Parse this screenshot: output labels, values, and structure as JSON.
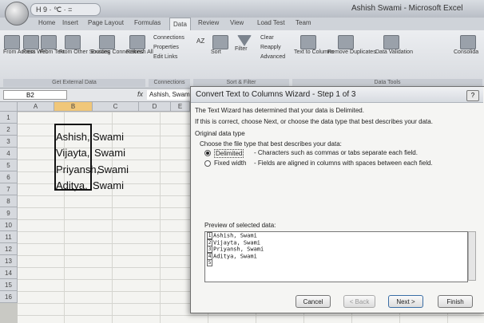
{
  "window": {
    "title": "Ashish Swami - Microsoft Excel",
    "qat_label": "H 9 · ℃ · ="
  },
  "ribbon": {
    "tabs": [
      "Home",
      "Insert",
      "Page Layout",
      "Formulas",
      "Data",
      "Review",
      "View",
      "Load Test",
      "Team"
    ],
    "active_tab": "Data",
    "buttons": {
      "from_access": "From Access",
      "from_web": "From Web",
      "from_text": "From Text",
      "from_other": "From Other Sources",
      "existing": "Existing Connections",
      "refresh": "Refresh All",
      "connections": "Connections",
      "properties": "Properties",
      "edit_links": "Edit Links",
      "sort": "Sort",
      "filter": "Filter",
      "clear": "Clear",
      "reapply": "Reapply",
      "advanced": "Advanced",
      "text_to_columns": "Text to Columns",
      "remove_duplicates": "Remove Duplicates",
      "data_validation": "Data Validation",
      "consolidate": "Consolida"
    },
    "groups": {
      "external": "Get External Data",
      "connections": "Connections",
      "sort_filter": "Sort & Filter",
      "data_tools": "Data Tools"
    }
  },
  "formula_bar": {
    "name_box": "B2",
    "fx": "fx",
    "value": "Ashish, Swami"
  },
  "grid": {
    "columns": [
      "A",
      "B",
      "C",
      "D",
      "E"
    ],
    "rows": [
      "1",
      "2",
      "3",
      "4",
      "5",
      "6",
      "7",
      "8",
      "9",
      "10",
      "11",
      "12",
      "13",
      "14",
      "15",
      "16"
    ],
    "cells": [
      {
        "b": "Ashish,",
        "c": "Swami"
      },
      {
        "b": "Vijayta,",
        "c": "Swami"
      },
      {
        "b": "Priyansh,",
        "c": "Swami"
      },
      {
        "b": "Aditya,",
        "c": "Swami"
      }
    ]
  },
  "dialog": {
    "title": "Convert Text to Columns Wizard - Step 1 of 3",
    "help": "?",
    "line1": "The Text Wizard has determined that your data is Delimited.",
    "line2": "If this is correct, choose Next, or choose the data type that best describes your data.",
    "original_type": "Original data type",
    "choose_type": "Choose the file type that best describes your data:",
    "opt_delimited": "Delimited",
    "opt_delimited_desc": "- Characters such as commas or tabs separate each field.",
    "opt_fixed": "Fixed width",
    "opt_fixed_desc": "- Fields are aligned in columns with spaces between each field.",
    "preview_label": "Preview of selected data:",
    "preview_lines": [
      {
        "n": "1",
        "text": "Ashish, Swami"
      },
      {
        "n": "2",
        "text": "Vijayta, Swami"
      },
      {
        "n": "3",
        "text": "Priyansh, Swami"
      },
      {
        "n": "4",
        "text": "Aditya, Swami"
      },
      {
        "n": "5",
        "text": ""
      }
    ],
    "btn_cancel": "Cancel",
    "btn_back": "< Back",
    "btn_next": "Next >",
    "btn_finish": "Finish"
  }
}
